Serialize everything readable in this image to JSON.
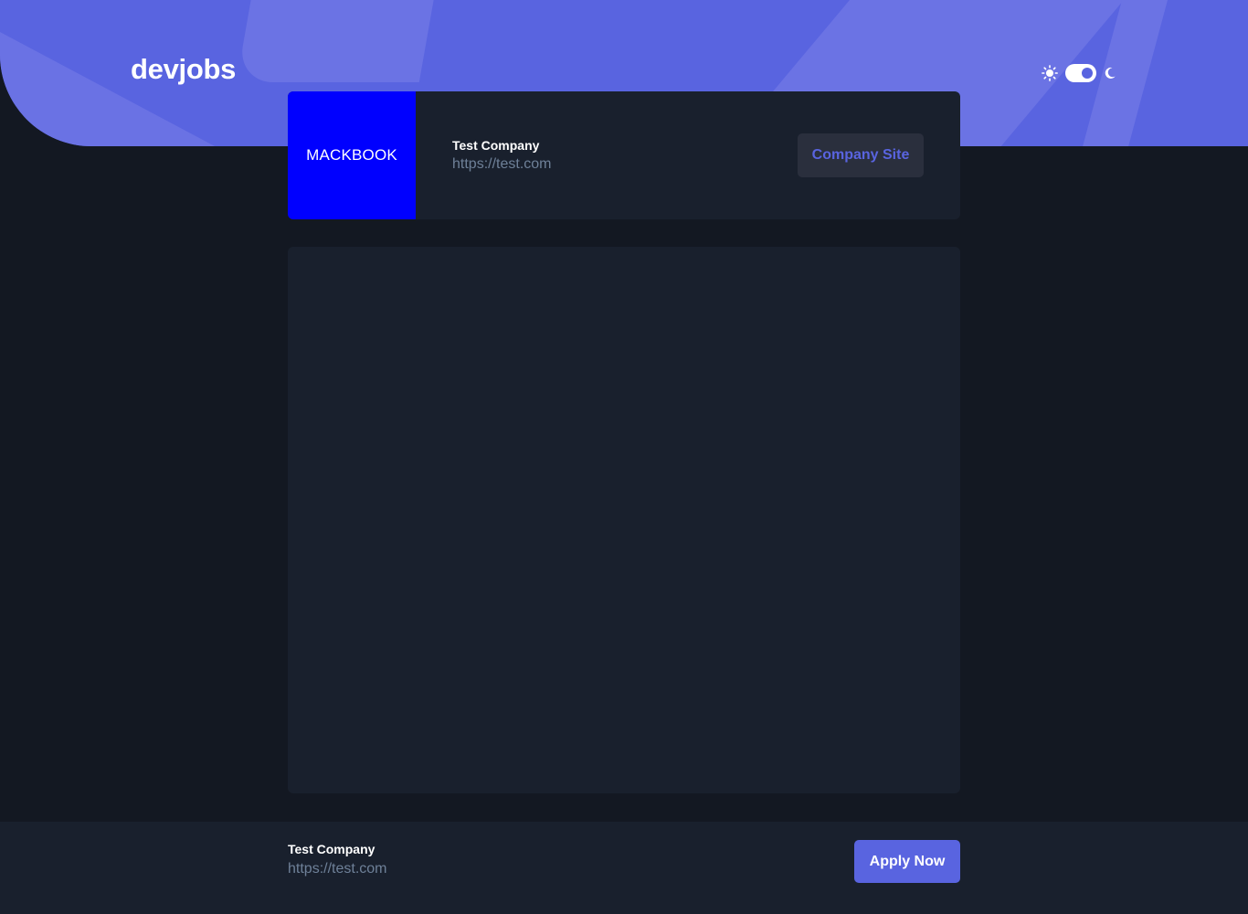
{
  "header": {
    "logo": "devjobs",
    "theme_toggle": {
      "sun_icon": "sun-icon",
      "moon_icon": "moon-icon",
      "mode": "dark"
    }
  },
  "company_card": {
    "logo_text": "MACKBOOK",
    "logo_color": "#0000ff",
    "name": "Test Company",
    "url": "https://test.com",
    "site_button_label": "Company Site"
  },
  "footer": {
    "name": "Test Company",
    "url": "https://test.com",
    "apply_label": "Apply Now"
  },
  "colors": {
    "accent": "#5964e0",
    "background": "#131822",
    "card": "#19202d",
    "muted_text": "#6e8098"
  }
}
